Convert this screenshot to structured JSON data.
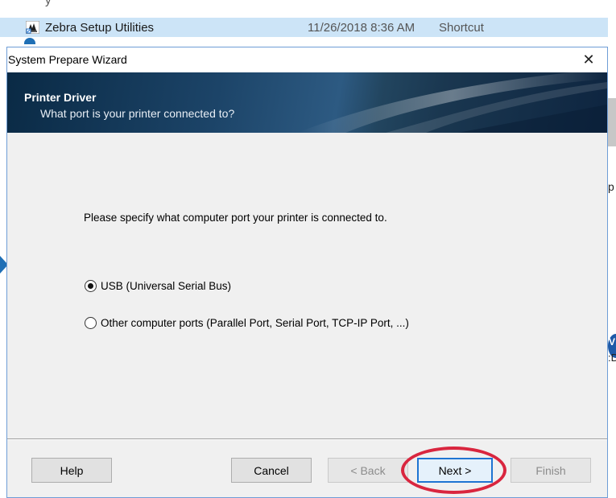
{
  "background": {
    "partial_row": {
      "name": "y",
      "date": "",
      "type": ""
    },
    "selected_row": {
      "name": "Zebra Setup Utilities",
      "date": "11/26/2018 8:36 AM",
      "type": "Shortcut"
    },
    "right_edge": {
      "letter_p": "p",
      "letter_v": "V",
      "colon_d": ":D"
    }
  },
  "dialog": {
    "title": "System Prepare Wizard",
    "close_glyph": "✕",
    "banner": {
      "title": "Printer Driver",
      "subtitle": "What port is your printer connected to?"
    },
    "prompt": "Please specify what computer port your printer is connected to.",
    "options": [
      {
        "label": "USB (Universal Serial Bus)",
        "selected": true
      },
      {
        "label": "Other computer ports (Parallel Port, Serial Port, TCP-IP Port, ...)",
        "selected": false
      }
    ],
    "buttons": {
      "help": "Help",
      "cancel": "Cancel",
      "back": "< Back",
      "next": "Next >",
      "finish": "Finish"
    }
  },
  "colors": {
    "accent": "#1f74d2",
    "highlight": "#d9263f",
    "banner_dark": "#0a2a45"
  },
  "icons": {
    "shortcut_icon": "zebra-shortcut-icon",
    "close_icon": "close-icon",
    "radio": "radio-button"
  }
}
